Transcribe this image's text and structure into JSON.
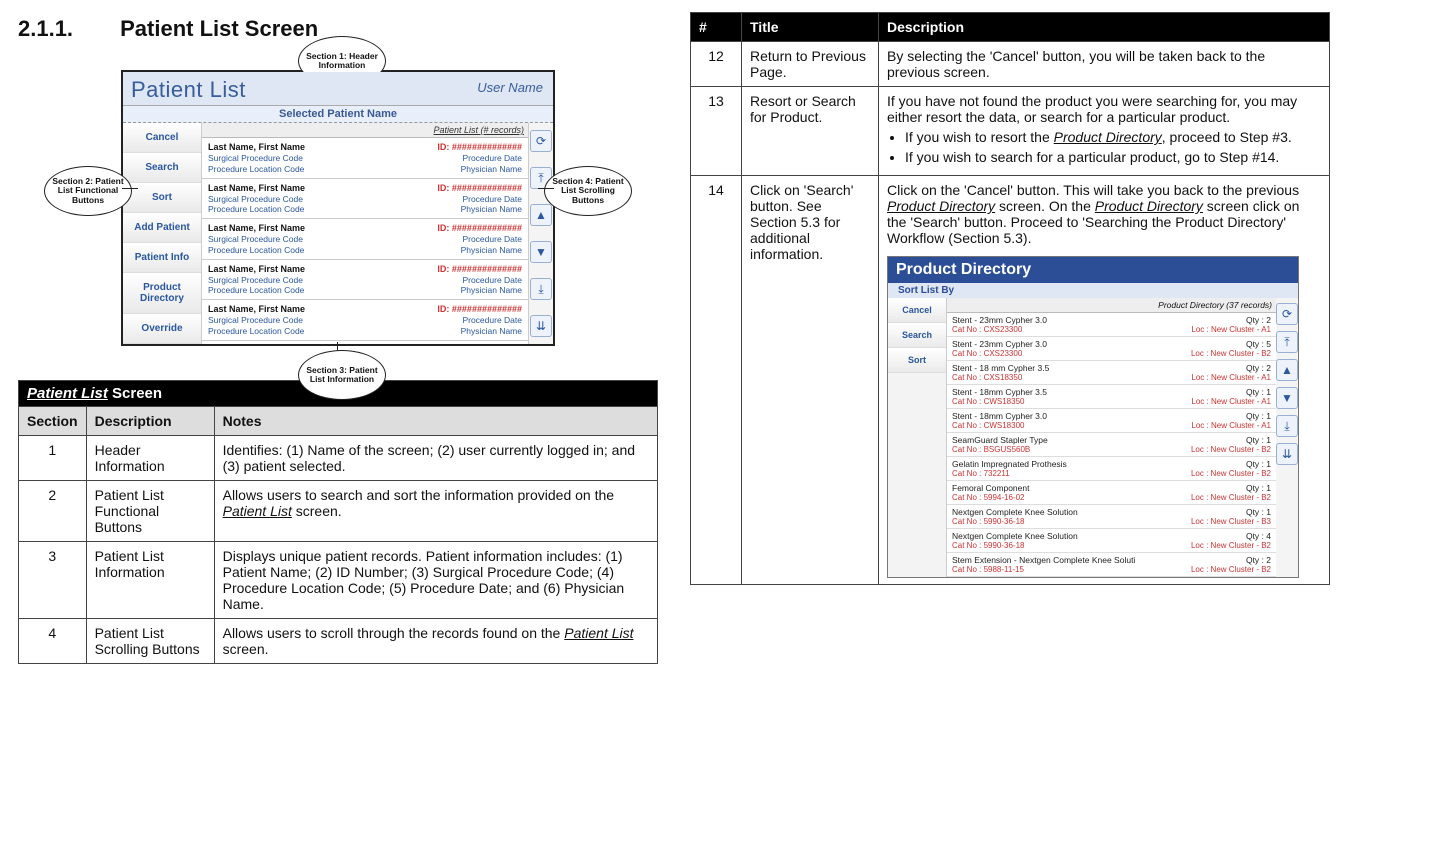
{
  "heading": {
    "num": "2.1.1.",
    "title": "Patient List Screen"
  },
  "callouts": {
    "s1": "Section 1: Header Information",
    "s2": "Section 2: Patient List Functional Buttons",
    "s3": "Section 3: Patient List Information",
    "s4": "Section 4: Patient List Scrolling Buttons"
  },
  "mock": {
    "title": "Patient List",
    "user": "User Name",
    "selected": "Selected Patient Name",
    "list_head": "Patient List (# records)",
    "sidebar": [
      "Cancel",
      "Search",
      "Sort",
      "Add Patient",
      "Patient Info",
      "Product Directory",
      "Override"
    ],
    "record": {
      "name": "Last Name, First Name",
      "id": "ID: ##############",
      "spc": "Surgical Procedure Code",
      "pdate": "Procedure Date",
      "plc": "Procedure Location Code",
      "phys": "Physician Name"
    },
    "scroll_icons": [
      "⟳",
      "⤒",
      "▲",
      "▼",
      "⤓",
      "⇊"
    ]
  },
  "pls_table": {
    "caption_ul": "Patient List",
    "caption_rest": " Screen",
    "head": [
      "Section",
      "Description",
      "Notes"
    ],
    "rows": [
      {
        "n": "1",
        "d": "Header Information",
        "t": "Identifies: (1) Name of the screen; (2) user currently logged in; and (3) patient selected."
      },
      {
        "n": "2",
        "d": "Patient List Functional Buttons",
        "t_pre": "Allows users to search and sort the information provided on the ",
        "t_ul": "Patient List",
        "t_post": " screen."
      },
      {
        "n": "3",
        "d": "Patient List Information",
        "t": "Displays unique patient records.  Patient information includes: (1) Patient Name; (2) ID Number; (3) Surgical Procedure Code; (4) Procedure Location Code; (5) Procedure Date; and (6) Physician Name."
      },
      {
        "n": "4",
        "d": "Patient List Scrolling Buttons",
        "t_pre": "Allows users to scroll through the records found on the ",
        "t_ul": "Patient List",
        "t_post": " screen."
      }
    ]
  },
  "steps_table": {
    "head": [
      "#",
      "Title",
      "Description"
    ],
    "rows": [
      {
        "n": "12",
        "title": "Return to Previous Page.",
        "plain": "By selecting the 'Cancel' button, you will be taken back to the previous screen."
      },
      {
        "n": "13",
        "title": "Resort or Search for Product.",
        "intro": "If you have not found the product you were searching for, you may either resort the data, or search for a particular product.",
        "b1_pre": "If you wish to resort the ",
        "b1_ul": "Product Directory",
        "b1_post": ", proceed to Step #3.",
        "b2": "If you wish to search for a particular product, go to Step #14."
      },
      {
        "n": "14",
        "title": "Click on 'Search' button.  See Section 5.3 for additional information.",
        "p_pre": "Click on the 'Cancel' button.  This will take you back to the previous ",
        "p_ul1": "Product Directory",
        "p_mid": " screen.  On the ",
        "p_ul2": "Product Directory",
        "p_post": " screen click on the 'Search' button.  Proceed to 'Searching the Product Directory' Workflow (Section 5.3)."
      }
    ]
  },
  "pd_mock": {
    "title": "Product Directory",
    "sort": "Sort List By",
    "list_head": "Product Directory (37 records)",
    "sidebar": [
      "Cancel",
      "Search",
      "Sort"
    ],
    "rows": [
      {
        "a": "Stent - 23mm Cypher 3.0",
        "q": "Qty : 2",
        "c": "Cat No : CXS23300",
        "l": "Loc : New Cluster -  A1"
      },
      {
        "a": "Stent - 23mm Cypher 3.0",
        "q": "Qty : 5",
        "c": "Cat No : CXS23300",
        "l": "Loc : New Cluster -  B2"
      },
      {
        "a": "Stent - 18 mm Cypher 3.5",
        "q": "Qty : 2",
        "c": "Cat No : CXS18350",
        "l": "Loc : New Cluster -  A1"
      },
      {
        "a": "Stent - 18mm Cypher 3.5",
        "q": "Qty : 1",
        "c": "Cat No : CWS18350",
        "l": "Loc : New Cluster -  A1"
      },
      {
        "a": "Stent - 18mm Cypher 3.0",
        "q": "Qty : 1",
        "c": "Cat No : CWS18300",
        "l": "Loc : New Cluster -  A1"
      },
      {
        "a": "SeamGuard Stapler Type",
        "q": "Qty : 1",
        "c": "Cat No : BSGUS560B",
        "l": "Loc : New Cluster -  B2"
      },
      {
        "a": "Gelatin Impregnated Prothesis",
        "q": "Qty : 1",
        "c": "Cat No : 732211",
        "l": "Loc : New Cluster -  B2"
      },
      {
        "a": "Femoral Component",
        "q": "Qty : 1",
        "c": "Cat No : 5994-16-02",
        "l": "Loc : New Cluster -  B2"
      },
      {
        "a": "Nextgen Complete Knee Solution",
        "q": "Qty : 1",
        "c": "Cat No : 5990-36-18",
        "l": "Loc : New Cluster -  B3"
      },
      {
        "a": "Nextgen Complete Knee Solution",
        "q": "Qty : 4",
        "c": "Cat No : 5990-36-18",
        "l": "Loc : New Cluster -  B2"
      },
      {
        "a": "Stem Extension - Nextgen Complete Knee Soluti",
        "q": "Qty : 2",
        "c": "Cat No : 5988-11-15",
        "l": "Loc : New Cluster -  B2"
      }
    ]
  }
}
